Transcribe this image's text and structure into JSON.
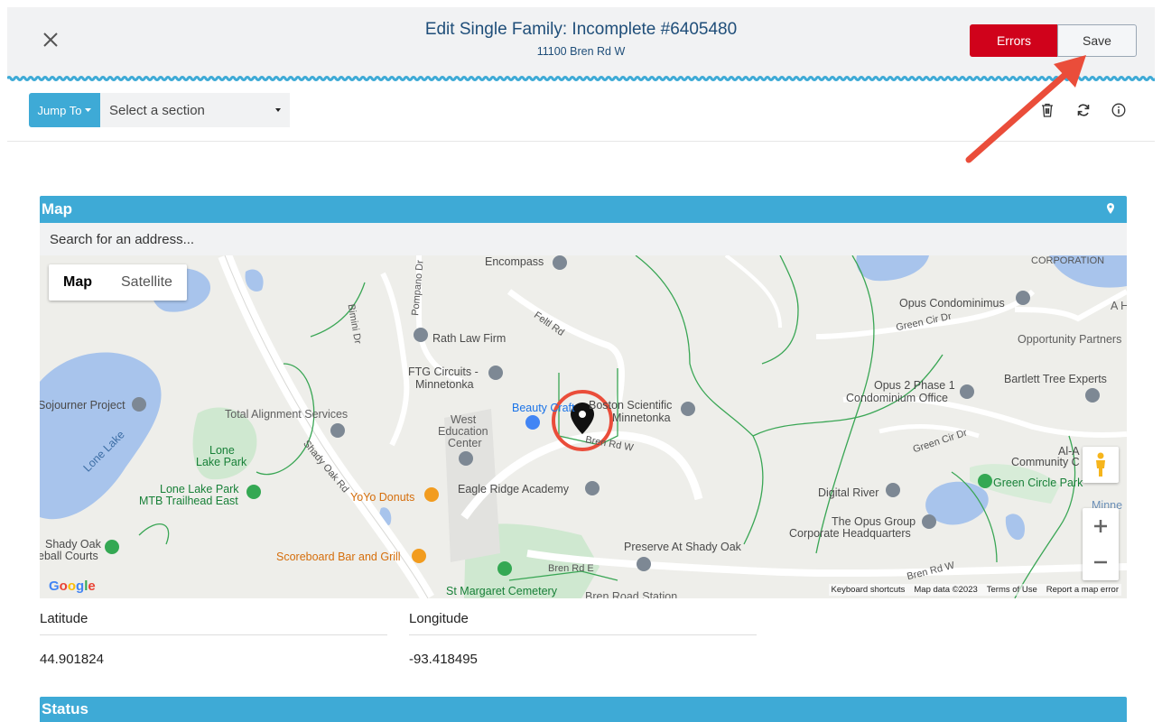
{
  "header": {
    "title": "Edit Single Family: Incomplete #6405480",
    "subtitle": "11100 Bren Rd W",
    "errors_label": "Errors",
    "save_label": "Save",
    "close_icon": "close-icon"
  },
  "toolbar": {
    "jump_label": "Jump To",
    "section_placeholder": "Select a section",
    "icons": [
      "trash-icon",
      "refresh-icon",
      "info-icon"
    ]
  },
  "colors": {
    "accent": "#3eaad6",
    "errors": "#d0021b",
    "title": "#1f4e79",
    "annotation": "#ea4d3a"
  },
  "map_section": {
    "title": "Map",
    "search_placeholder": "Search for an address...",
    "map_type": {
      "map_label": "Map",
      "satellite_label": "Satellite"
    },
    "labels": {
      "encompass": "Encompass",
      "corporation": "CORPORATION",
      "opus_condos": "Opus Condominimus",
      "a_h": "A H",
      "green_cir_dr_1": "Green Cir Dr",
      "opportunity": "Opportunity Partners",
      "feltl_rd": "Feltl Rd",
      "rath": "Rath Law Firm",
      "bartlett": "Bartlett Tree Experts",
      "ftg_1": "FTG Circuits -",
      "ftg_2": "Minnetonka",
      "opus2_1": "Opus 2 Phase 1",
      "opus2_2": "Condominium Office",
      "sojourner": "Sojourner Project",
      "beauty": "Beauty Craft",
      "boston_1": "Boston Scientific",
      "boston_2": "Minnetonka",
      "total_alignment": "Total Alignment Services",
      "west_ed_1": "West",
      "west_ed_2": "Education",
      "west_ed_3": "Center",
      "bren_rd_w": "Bren Rd W",
      "green_cir_dr_2": "Green Cir Dr",
      "al_a": "Al-A",
      "community": "Community C",
      "lone_lake": "Lone Lake",
      "lone_lake_park_1": "Lone",
      "lone_lake_park_2": "Lake Park",
      "shady_oak_rd": "Shady Oak Rd",
      "lone_lake_mtb_1": "Lone Lake Park",
      "lone_lake_mtb_2": "MTB Trailhead East",
      "yoyo": "YoYo Donuts",
      "eagle_ridge": "Eagle Ridge Academy",
      "digital_river": "Digital River",
      "green_circle_park": "Green Circle Park",
      "minne": "Minne",
      "opus_group_1": "The Opus Group",
      "opus_group_2": "Corporate Headquarters",
      "shady_oak_courts_1": "Shady Oak",
      "shady_oak_courts_2": "eball Courts",
      "scoreboard": "Scoreboard Bar and Grill",
      "preserve": "Preserve At Shady Oak",
      "bren_rd_e": "Bren Rd E",
      "bren_rd_w_2": "Bren Rd W",
      "st_margaret": "St Margaret Cemetery",
      "bren_rd_station": "Bren Road Station",
      "bimini_dr": "Bimini Dr",
      "pompano_dr": "Pompano Dr"
    },
    "google": "Google",
    "footer": {
      "shortcuts": "Keyboard shortcuts",
      "map_data": "Map data ©2023",
      "terms": "Terms of Use",
      "report": "Report a map error"
    }
  },
  "coordinates": {
    "latitude_label": "Latitude",
    "longitude_label": "Longitude",
    "latitude_value": "44.901824",
    "longitude_value": "-93.418495"
  },
  "status_section": {
    "title": "Status"
  }
}
